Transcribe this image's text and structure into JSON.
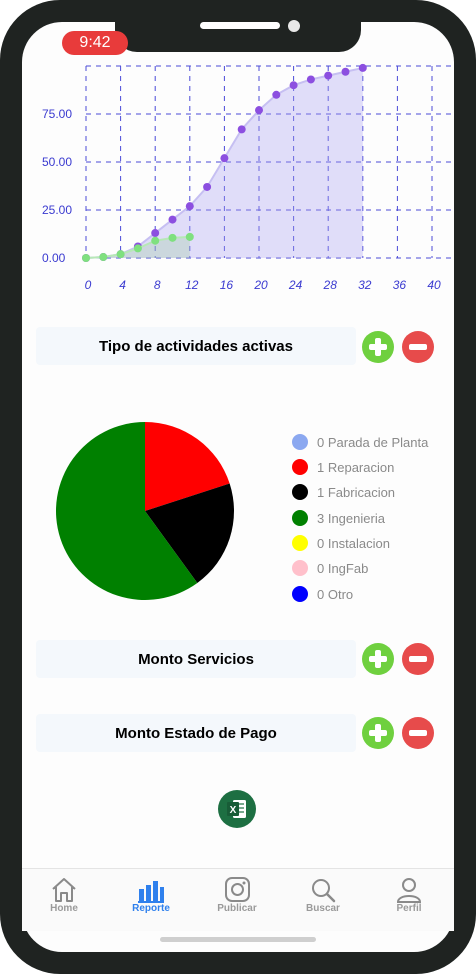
{
  "status_bar": {
    "time": "9:42"
  },
  "line_chart": {
    "y_ticks": [
      "0.00",
      "25.00",
      "50.00",
      "75.00"
    ],
    "x_ticks": [
      "0",
      "4",
      "8",
      "12",
      "16",
      "20",
      "24",
      "28",
      "32",
      "36",
      "40"
    ],
    "series": [
      {
        "color": "#8c4fe0",
        "points": [
          [
            0,
            0
          ],
          [
            2,
            0.5
          ],
          [
            4,
            2
          ],
          [
            6,
            6
          ],
          [
            8,
            13
          ],
          [
            10,
            20
          ],
          [
            12,
            27
          ],
          [
            14,
            37
          ],
          [
            16,
            52
          ],
          [
            18,
            67
          ],
          [
            20,
            77
          ],
          [
            22,
            85
          ],
          [
            24,
            90
          ],
          [
            26,
            93
          ],
          [
            28,
            95
          ],
          [
            30,
            97
          ],
          [
            32,
            99
          ]
        ]
      },
      {
        "color": "#7fe07f",
        "points": [
          [
            0,
            0
          ],
          [
            2,
            0.5
          ],
          [
            4,
            2
          ],
          [
            6,
            5
          ],
          [
            8,
            9
          ],
          [
            10,
            10.5
          ],
          [
            12,
            11
          ]
        ]
      }
    ]
  },
  "activities": {
    "title": "Tipo de actividades activas",
    "add_label": "add",
    "remove_label": "remove",
    "legend": [
      {
        "label": "0 Parada de Planta",
        "color": "#8ba8f0"
      },
      {
        "label": "1 Reparacion",
        "color": "#ff0000"
      },
      {
        "label": "1 Fabricacion",
        "color": "#000000"
      },
      {
        "label": "3 Ingenieria",
        "color": "#008000"
      },
      {
        "label": "0 Instalacion",
        "color": "#ffff00"
      },
      {
        "label": "0 IngFab",
        "color": "#ffc0cb"
      },
      {
        "label": "0 Otro",
        "color": "#0000ff"
      }
    ]
  },
  "chart_data": [
    {
      "type": "line",
      "series": [
        {
          "x": [
            0,
            2,
            4,
            6,
            8,
            10,
            12,
            14,
            16,
            18,
            20,
            22,
            24,
            26,
            28,
            30,
            32
          ],
          "values": [
            0,
            0.5,
            2,
            6,
            13,
            20,
            27,
            37,
            52,
            67,
            77,
            85,
            90,
            93,
            95,
            97,
            99
          ]
        },
        {
          "x": [
            0,
            2,
            4,
            6,
            8,
            10,
            12
          ],
          "values": [
            0,
            0.5,
            2,
            5,
            9,
            10.5,
            11
          ]
        }
      ],
      "ylim": [
        0,
        100
      ]
    },
    {
      "type": "pie",
      "categories": [
        "Parada de Planta",
        "Reparacion",
        "Fabricacion",
        "Ingenieria",
        "Instalacion",
        "IngFab",
        "Otro"
      ],
      "values": [
        0,
        1,
        1,
        3,
        0,
        0,
        0
      ]
    }
  ],
  "montos": {
    "servicios_title": "Monto Servicios",
    "estado_pago_title": "Monto Estado de Pago"
  },
  "tabbar": {
    "home": "Home",
    "reporte": "Reporte",
    "publicar": "Publicar",
    "buscar": "Buscar",
    "perfil": "Perfil"
  },
  "colors": {
    "accent": "#2f80ed",
    "add": "#6fd03f",
    "remove": "#e74b4b"
  }
}
